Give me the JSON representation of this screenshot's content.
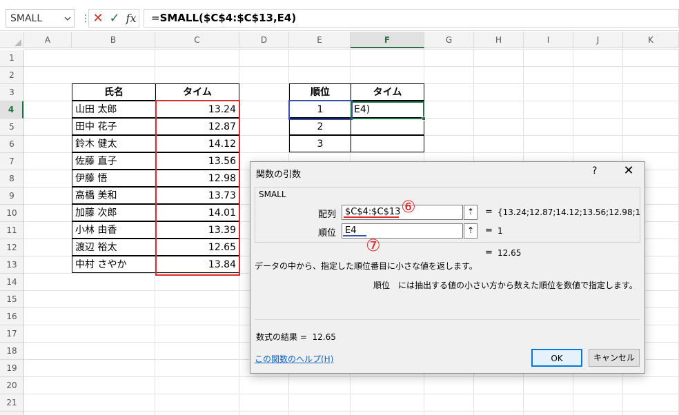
{
  "formula_bar": {
    "name_box": "SMALL",
    "formula_prefix": "=",
    "formula_func": "SMALL",
    "formula_args": "($C$4:$C$13,E4)",
    "cancel_icon": "✕",
    "enter_icon": "✓",
    "fx_icon": "fx"
  },
  "columns": [
    "A",
    "B",
    "C",
    "D",
    "E",
    "F",
    "G",
    "H",
    "I",
    "J",
    "K"
  ],
  "rows": [
    "1",
    "2",
    "3",
    "4",
    "5",
    "6",
    "7",
    "8",
    "9",
    "10",
    "11",
    "12",
    "13",
    "14",
    "15",
    "16",
    "17",
    "18",
    "19",
    "20",
    "21"
  ],
  "left_table": {
    "headers": [
      "氏名",
      "タイム"
    ],
    "rows": [
      {
        "name": "山田 太郎",
        "time": "13.24"
      },
      {
        "name": "田中 花子",
        "time": "12.87"
      },
      {
        "name": "鈴木 健太",
        "time": "14.12"
      },
      {
        "name": "佐藤 直子",
        "time": "13.56"
      },
      {
        "name": "伊藤 悟",
        "time": "12.98"
      },
      {
        "name": "高橋 美和",
        "time": "13.73"
      },
      {
        "name": "加藤 次郎",
        "time": "14.01"
      },
      {
        "name": "小林 由香",
        "time": "13.39"
      },
      {
        "name": "渡辺 裕太",
        "time": "12.65"
      },
      {
        "name": "中村 さやか",
        "time": "13.84"
      }
    ]
  },
  "right_table": {
    "headers": [
      "順位",
      "タイム"
    ],
    "rows": [
      {
        "rank": "1",
        "time": "E4)"
      },
      {
        "rank": "2",
        "time": ""
      },
      {
        "rank": "3",
        "time": ""
      }
    ]
  },
  "dialog": {
    "title": "関数の引数",
    "help_icon": "?",
    "close_icon": "✕",
    "function_name": "SMALL",
    "arg1_label": "配列",
    "arg1_value": "$C$4:$C$13",
    "arg1_preview": "{13.24;12.87;14.12;13.56;12.98;1",
    "arg2_label": "順位",
    "arg2_value": "E4",
    "arg2_preview": "1",
    "equals": "=",
    "func_preview": "12.65",
    "description": "データの中から、指定した順位番目に小さな値を返します。",
    "arg_description": "順位　には抽出する値の小さい方から数えた順位を数値で指定します。",
    "result_label": "数式の結果 =",
    "result_value": "12.65",
    "help_link": "この関数のヘルプ(H)",
    "ok_label": "OK",
    "cancel_label": "キャンセル",
    "collapse_icon": "⇡"
  },
  "annotations": {
    "mark_6": "⑥",
    "mark_7": "⑦",
    "red_color": "#e02b2b",
    "blue_color": "#3a4db0"
  }
}
